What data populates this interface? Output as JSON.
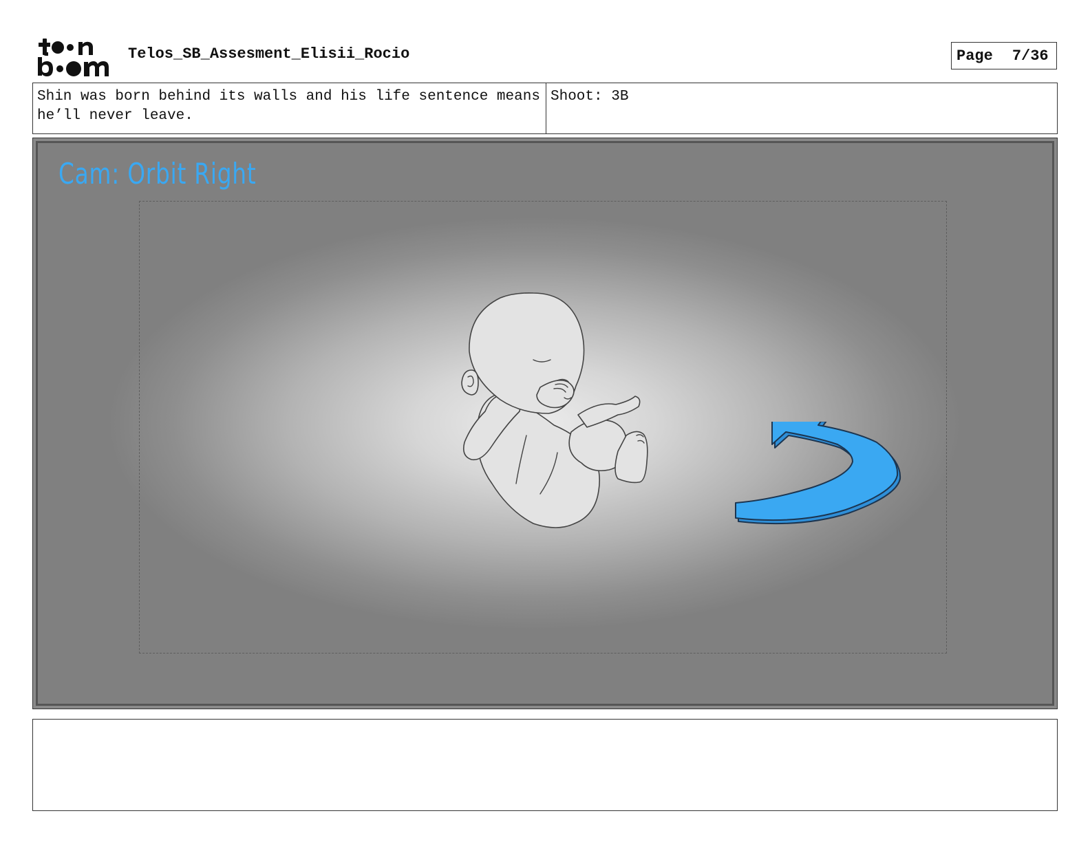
{
  "logo": {
    "line1": "toon",
    "line2": "boom"
  },
  "header": {
    "title": "Telos_SB_Assesment_Elisii_Rocio",
    "page_label": "Page",
    "page_number": "7/36"
  },
  "info": {
    "dialog": "Shin was born behind its walls and his life sentence means he’ll never leave.",
    "shoot": "Shoot: 3B"
  },
  "panel": {
    "camera_note": "Cam: Orbit Right",
    "icons": [
      "sleeping-baby-drawing",
      "orbit-right-arrow-icon"
    ],
    "colors": {
      "accent": "#3aa8f2",
      "panel_bg": "#808080"
    }
  },
  "notes": {
    "text": ""
  }
}
